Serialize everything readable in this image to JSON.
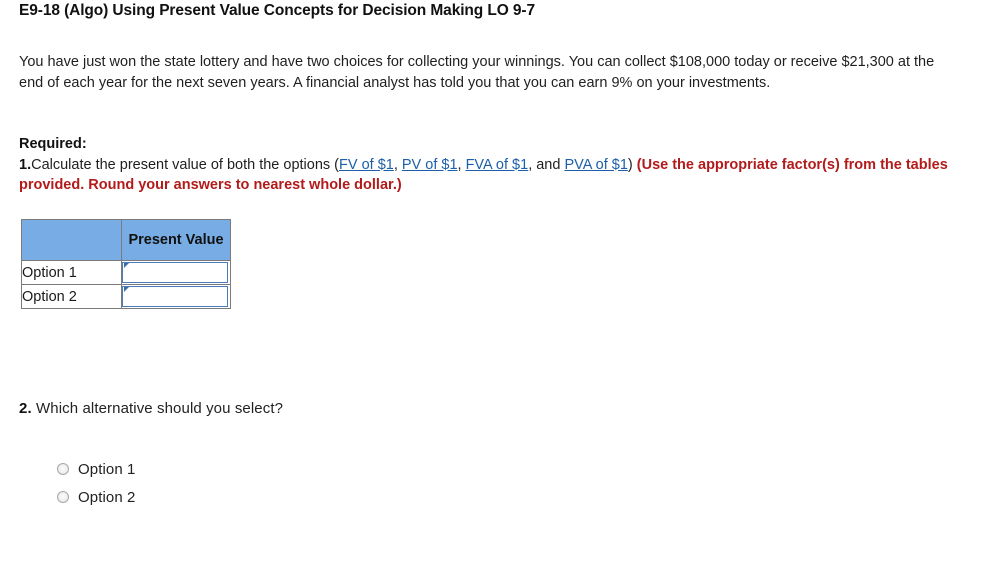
{
  "title": "E9-18 (Algo) Using Present Value Concepts for Decision Making LO 9-7",
  "problem": {
    "text": "You have just won the state lottery and have two choices for collecting your winnings. You can collect $108,000 today or receive $21,300 at the end of each year for the next seven years. A financial analyst has told you that you can earn 9% on your investments."
  },
  "required": {
    "heading": "Required:",
    "item1": {
      "number": "1.",
      "text_before": "Calculate the present value of both the options (",
      "links": [
        {
          "label": "FV of $1"
        },
        {
          "label": "PV of $1"
        },
        {
          "label": "FVA of $1"
        },
        {
          "label": "PVA of $1"
        }
      ],
      "separator": ", ",
      "conjunction": ", and ",
      "text_after": ")",
      "instruction": "(Use the appropriate factor(s) from the tables provided. Round your answers to nearest whole dollar.)"
    }
  },
  "answer_table": {
    "headers": [
      "",
      "Present Value"
    ],
    "rows": [
      {
        "label": "Option 1",
        "value": "",
        "placeholder": ""
      },
      {
        "label": "Option 2",
        "value": "",
        "placeholder": ""
      }
    ]
  },
  "question2": {
    "number": "2.",
    "text": "Which alternative should you select?",
    "options": [
      {
        "label": "Option 1",
        "selected": false
      },
      {
        "label": "Option 2",
        "selected": false
      }
    ]
  },
  "colors": {
    "header_blue": "#77ace4",
    "link_blue": "#1c5fa8",
    "instruction_red": "#b31b1b",
    "input_border": "#4a7dba",
    "table_border": "#7b7b7b"
  }
}
